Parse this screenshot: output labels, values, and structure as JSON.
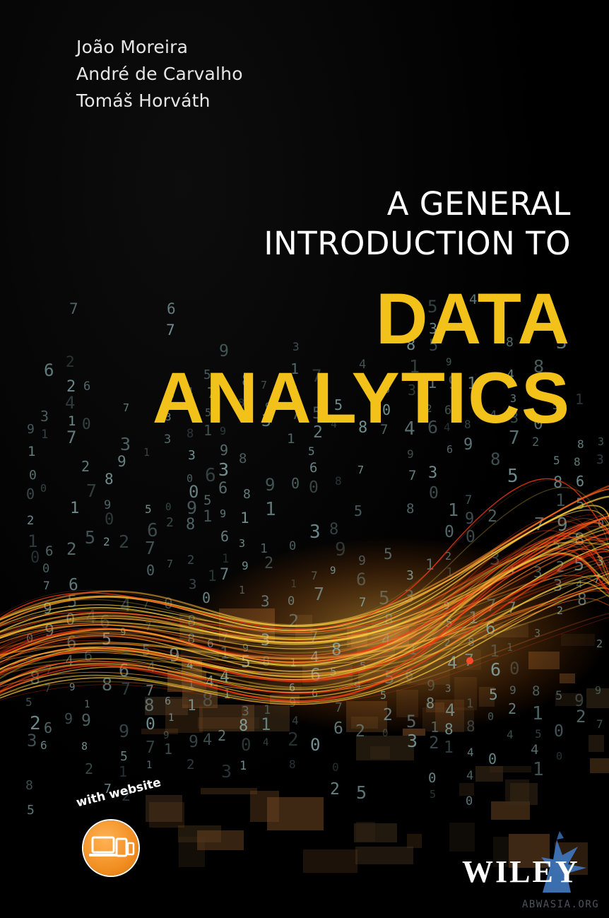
{
  "authors": [
    "João Moreira",
    "André de Carvalho",
    "Tomáš Horváth"
  ],
  "subtitle_lines": [
    "A GENERAL",
    "INTRODUCTION TO"
  ],
  "title_lines": [
    "DATA",
    "ANALYTICS"
  ],
  "badge": {
    "label": "with website",
    "icon": "devices-icon"
  },
  "publisher": "WILEY",
  "watermark": "ABWASIA.ORG",
  "colors": {
    "background": "#000000",
    "title": "#f2c21b",
    "text": "#ffffff",
    "badge": "#f08c1e",
    "digits": "#8fb6b8"
  }
}
